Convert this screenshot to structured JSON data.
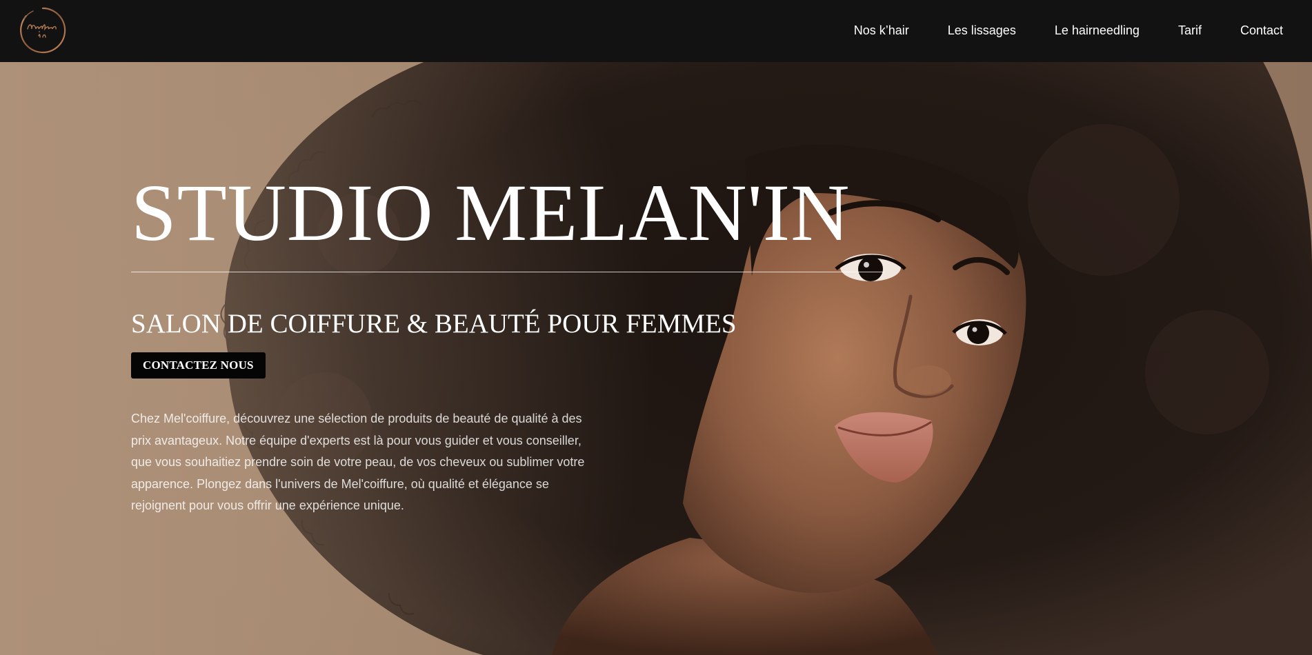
{
  "header": {
    "logo_alt": "Melan'in",
    "nav": [
      {
        "label": "Nos k’hair"
      },
      {
        "label": "Les lissages"
      },
      {
        "label": "Le hairneedling"
      },
      {
        "label": "Tarif"
      },
      {
        "label": "Contact"
      }
    ]
  },
  "hero": {
    "title": "STUDIO MELAN'IN",
    "subtitle": "SALON DE COIFFURE & BEAUTÉ POUR FEMMES",
    "cta_label": "CONTACTEZ NOUS",
    "description": "Chez Mel'coiffure, découvrez une sélection de produits de beauté de qualité à des prix avantageux. Notre équipe d'experts est là pour vous guider et vous conseiller, que vous souhaitiez prendre soin de votre peau, de vos cheveux ou sublimer votre apparence. Plongez dans l'univers de Mel'coiffure, où qualité et élégance se rejoignent pour vous offrir une expérience unique.",
    "background_image": "woman-portrait-afro-hair"
  },
  "colors": {
    "header_bg": "#121212",
    "hero_bg": "#a88b74",
    "hair": "#1f1612",
    "skin": "#8a5a40",
    "text": "#ffffff",
    "button_bg": "#050505",
    "logo_accent": "#b07a52"
  }
}
